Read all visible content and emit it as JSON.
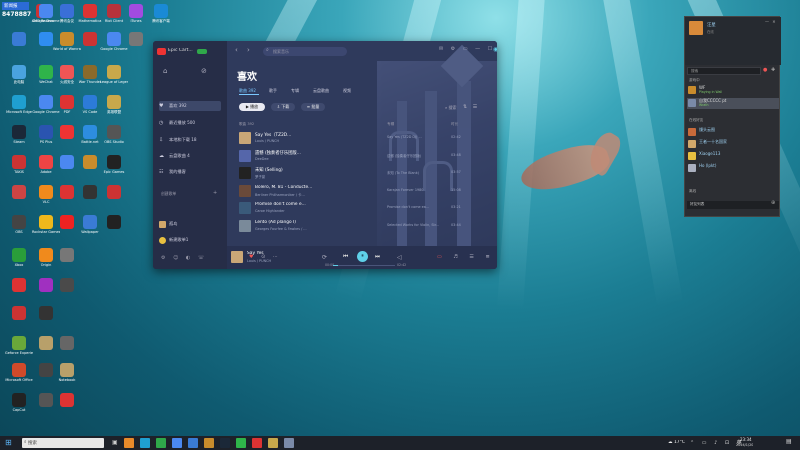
{
  "desktop_badge": {
    "line1": "新闻报",
    "line2": "8478887"
  },
  "desktop_icons": [
    {
      "label": "AMD Radeon",
      "color": "#c33"
    },
    {
      "label": "Google Chrome",
      "color": "#4b88f0"
    },
    {
      "label": "腾讯会议",
      "color": "#3a6fd8"
    },
    {
      "label": "Mathematica",
      "color": "#d33"
    },
    {
      "label": "Riot Client",
      "color": "#b7323b"
    },
    {
      "label": "ITunes",
      "color": "#a24be0"
    },
    {
      "label": "腾讯客户端",
      "color": "#1a8ad6"
    },
    {
      "label": "",
      "color": "#3a7bd5"
    },
    {
      "label": "",
      "color": "#2f8df0"
    },
    {
      "label": "World of Warcraft",
      "color": "#c98c2c"
    },
    {
      "label": "",
      "color": "#c33"
    },
    {
      "label": "Google Chrome",
      "color": "#4b88f0"
    },
    {
      "label": "",
      "color": "#777"
    },
    {
      "label": "此电脑",
      "color": "#4aa3df"
    },
    {
      "label": "WeChat",
      "color": "#2fb44a"
    },
    {
      "label": "火绒安全",
      "color": "#e55"
    },
    {
      "label": "War Thunder",
      "color": "#8a6a2a"
    },
    {
      "label": "League of Legends",
      "color": "#c8a84b"
    },
    {
      "label": "Microsoft Edge",
      "color": "#1f9fd0"
    },
    {
      "label": "Google Chrome",
      "color": "#4b88f0"
    },
    {
      "label": "PDF",
      "color": "#d33"
    },
    {
      "label": "VS Code",
      "color": "#2c7bd8"
    },
    {
      "label": "英雄联盟",
      "color": "#c8a84b"
    },
    {
      "label": "Steam",
      "color": "#1b2838"
    },
    {
      "label": "PS Plus",
      "color": "#2a54b0"
    },
    {
      "label": "",
      "color": "#e33"
    },
    {
      "label": "Battle.net",
      "color": "#2d8de0"
    },
    {
      "label": "OBS Studio",
      "color": "#555"
    },
    {
      "label": "TAKIS",
      "color": "#c33"
    },
    {
      "label": "Adobe",
      "color": "#e44"
    },
    {
      "label": "",
      "color": "#4b88f0"
    },
    {
      "label": "",
      "color": "#c98c2c"
    },
    {
      "label": "Epic Games",
      "color": "#222"
    },
    {
      "label": "",
      "color": "#c44"
    },
    {
      "label": "VLC",
      "color": "#f08a1c"
    },
    {
      "label": "",
      "color": "#d33"
    },
    {
      "label": "",
      "color": "#333"
    },
    {
      "label": "",
      "color": "#c33"
    },
    {
      "label": "OBS",
      "color": "#444"
    },
    {
      "label": "Rockstar Games",
      "color": "#f0b81c"
    },
    {
      "label": "",
      "color": "#e22"
    },
    {
      "label": "Wallpaper",
      "color": "#3a7bd5"
    },
    {
      "label": "",
      "color": "#222"
    },
    {
      "label": "Xbox",
      "color": "#2a9d3a"
    },
    {
      "label": "Origin",
      "color": "#f08a1c"
    },
    {
      "label": "",
      "color": "#777"
    },
    {
      "label": "",
      "color": "#d33"
    },
    {
      "label": "",
      "color": "#a030c0"
    },
    {
      "label": "",
      "color": "#4a4a4a"
    },
    {
      "label": "",
      "color": "#c33"
    },
    {
      "label": "",
      "color": "#333"
    },
    {
      "label": "Geforce Experience",
      "color": "#6aa83a"
    },
    {
      "label": "",
      "color": "#b8a06a"
    },
    {
      "label": "",
      "color": "#666"
    },
    {
      "label": "Microsoft Office",
      "color": "#d04a2a"
    },
    {
      "label": "",
      "color": "#444"
    },
    {
      "label": "Notebook",
      "color": "#b8a06a"
    },
    {
      "label": "CapCut",
      "color": "#222"
    },
    {
      "label": "",
      "color": "#555"
    },
    {
      "label": "",
      "color": "#d33"
    },
    {
      "label": "Recycle Bin",
      "color": "#666"
    },
    {
      "label": "Live Panorama",
      "color": "#333"
    },
    {
      "label": "",
      "color": "#2a6dd6"
    },
    {
      "label": "ask",
      "color": "#333"
    },
    {
      "label": "",
      "color": "#a33"
    }
  ],
  "music": {
    "app_name": "Epic Cart...",
    "search_placeholder": "搜索音乐",
    "nav": [
      {
        "icon": "♥",
        "label": "喜欢 392"
      },
      {
        "icon": "◷",
        "label": "最近播放 500"
      },
      {
        "icon": "⇩",
        "label": "本地和下载 18"
      },
      {
        "icon": "☁",
        "label": "云盘歌曲 4"
      },
      {
        "icon": "☷",
        "label": "我的播客"
      }
    ],
    "playlists_title": "创建歌单",
    "playlists": [
      {
        "label": "孤岛"
      },
      {
        "label": "新建歌单1"
      }
    ],
    "heading": "喜欢",
    "tabs": [
      "歌曲 392",
      "歌手",
      "专辑",
      "云盘歌曲",
      "视频"
    ],
    "actions": {
      "play": "▶ 播放",
      "download": "⇩ 下载",
      "manage": "≡ 批量"
    },
    "search_label": "搜索",
    "col_title": "歌曲 392",
    "col_album": "专辑",
    "col_time": "时长",
    "songs": [
      {
        "title": "Say Yes（TZ2D...",
        "artist": "Louis / PUNCH",
        "album": "Say Yes (TZ2D DJ) ...",
        "time": "02:42",
        "color": "#c9a777"
      },
      {
        "title": "遗憾 (独奏者仔乐团版...",
        "artist": "DeeDee",
        "album": "遗憾 (独奏者仔乐团版)",
        "time": "03:48",
        "color": "#5566aa"
      },
      {
        "title": "未知 (Selling)",
        "artist": "罗子豪",
        "album": "未知 (To The Blank)",
        "time": "03:57",
        "color": "#222"
      },
      {
        "title": "Bolero, M. 81 - Conducte...",
        "artist": "Berliner Philharmoniker / 卡...",
        "album": "Karajan Forever 1980",
        "time": "15:08",
        "color": "#6a4a3a"
      },
      {
        "title": "Promise don't come e...",
        "artist": "Caroe Highlander",
        "album": "Promise don't come ea...",
        "time": "03:21",
        "color": "#3a5a7a"
      },
      {
        "title": "Lento (Ad plango I)",
        "artist": "Georges Fourfee & Fawkes / ...",
        "album": "Selected Works for Violin, Str...",
        "time": "03:44",
        "color": "#7a8a9a"
      }
    ],
    "now_playing": {
      "title": "Say Yes",
      "artist": "Louis / PUNCH",
      "elapsed": "00:00",
      "total": "02:42",
      "progress": 0.08
    }
  },
  "chat": {
    "username": "汪星",
    "status": "在线",
    "search_placeholder": "搜索",
    "groups": [
      {
        "title": "游戏中",
        "items": [
          {
            "name": "WF",
            "status": "Playing in Wall",
            "color": "#c98c2c"
          },
          {
            "name": "自我CCCCC  pt",
            "status": "Wrath",
            "color": "#7a8aa8"
          }
        ]
      },
      {
        "title": "在线好友",
        "items": [
          {
            "name": "馒头云图",
            "status": "",
            "color": "#c86a3a"
          },
          {
            "name": "王者一十名国家",
            "status": "",
            "color": "#d2a86a"
          },
          {
            "name": "Xiaoge113",
            "status": "",
            "color": "#e8c040"
          },
          {
            "name": "Ho (lpkt)",
            "status": "",
            "color": "#aab0c0"
          }
        ]
      }
    ],
    "offline_title": "离线",
    "footer_label": "好友列表"
  },
  "taskbar": {
    "search_placeholder": "搜索",
    "weather": "17°C",
    "time": "23:34",
    "date": "2024/1/20",
    "apps": [
      {
        "color": "#e88a2a"
      },
      {
        "color": "#1f9fd0"
      },
      {
        "color": "#2fa84a"
      },
      {
        "color": "#4b88f0"
      },
      {
        "color": "#3a7bd5"
      },
      {
        "color": "#c98c2c"
      },
      {
        "color": "#1b2838"
      },
      {
        "color": "#2fb44a"
      },
      {
        "color": "#d33"
      },
      {
        "color": "#c8a84b"
      },
      {
        "color": "#7a8aa8"
      }
    ]
  }
}
